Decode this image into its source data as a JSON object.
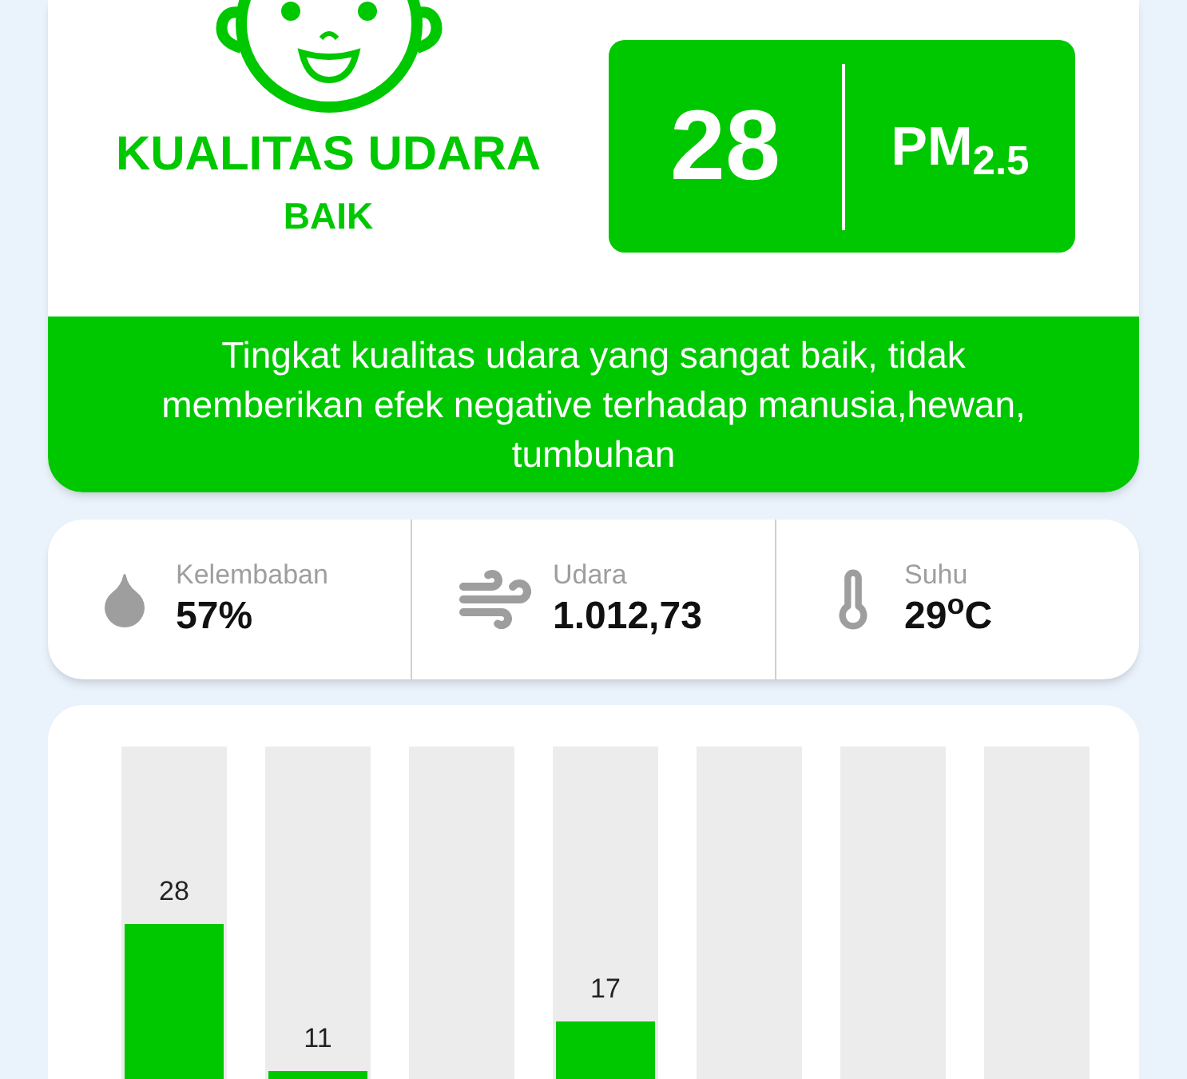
{
  "air_quality": {
    "label": "KUALITAS UDARA",
    "status": "BAIK",
    "value": "28",
    "unit": "PM$_{2.5}$",
    "description": "Tingkat kualitas udara yang sangat baik, tidak memberikan efek negative terhadap manusia,hewan, tumbuhan"
  },
  "stats": [
    {
      "kind": "humidity",
      "label": "Kelembaban",
      "value": "57%"
    },
    {
      "kind": "wind",
      "label": "Udara",
      "value": "1.012,73"
    },
    {
      "kind": "temperature",
      "label": "Suhu",
      "value": "29$^{o}$C"
    }
  ],
  "history": {
    "bars": [
      {
        "kind": "filled",
        "value": "28",
        "level": 0.58
      },
      {
        "kind": "filled",
        "value": "11",
        "level": 0.23
      },
      {
        "kind": "empty"
      },
      {
        "kind": "filled",
        "value": "17",
        "level": 0.35
      },
      {
        "kind": "empty"
      },
      {
        "kind": "empty"
      },
      {
        "kind": "empty"
      }
    ]
  }
}
